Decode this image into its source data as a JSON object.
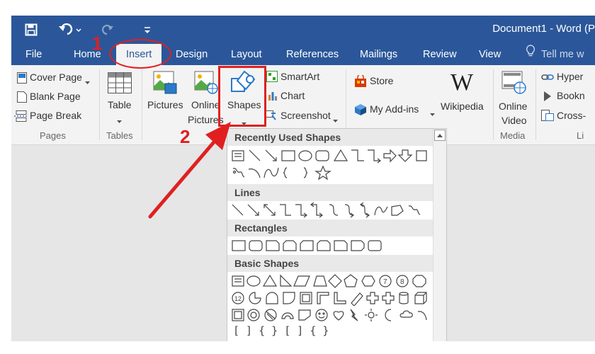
{
  "titlebar": {
    "doc_title": "Document1 - Word (P",
    "bg_color": "#2b579a"
  },
  "tabs": [
    {
      "label": "File"
    },
    {
      "label": "Home"
    },
    {
      "label": "Insert"
    },
    {
      "label": "Design"
    },
    {
      "label": "Layout"
    },
    {
      "label": "References"
    },
    {
      "label": "Mailings"
    },
    {
      "label": "Review"
    },
    {
      "label": "View"
    },
    {
      "label": "Tell me w"
    }
  ],
  "ribbon": {
    "pages": {
      "cover_page": "Cover Page",
      "blank_page": "Blank Page",
      "page_break": "Page Break",
      "label": "Pages"
    },
    "tables": {
      "table": "Table",
      "label": "Tables"
    },
    "illustrations": {
      "pictures": "Pictures",
      "online_pictures_1": "Online",
      "online_pictures_2": "Pictures",
      "shapes": "Shapes",
      "smartart": "SmartArt",
      "chart": "Chart",
      "screenshot": "Screenshot"
    },
    "addins": {
      "store": "Store",
      "my_addins": "My Add-ins",
      "wikipedia": "Wikipedia"
    },
    "media": {
      "online_video_1": "Online",
      "online_video_2": "Video",
      "label": "Media"
    },
    "links": {
      "hyperlink": "Hyper",
      "bookmark": "Bookn",
      "cross_ref": "Cross-",
      "label": "Li"
    }
  },
  "gallery": {
    "sections": [
      {
        "title": "Recently Used Shapes"
      },
      {
        "title": "Lines"
      },
      {
        "title": "Rectangles"
      },
      {
        "title": "Basic Shapes"
      }
    ],
    "braces_text": "[ ] { } [   ]  {   }"
  },
  "annotations": {
    "step1": "1",
    "step2": "2",
    "highlight_color": "#e02020"
  }
}
